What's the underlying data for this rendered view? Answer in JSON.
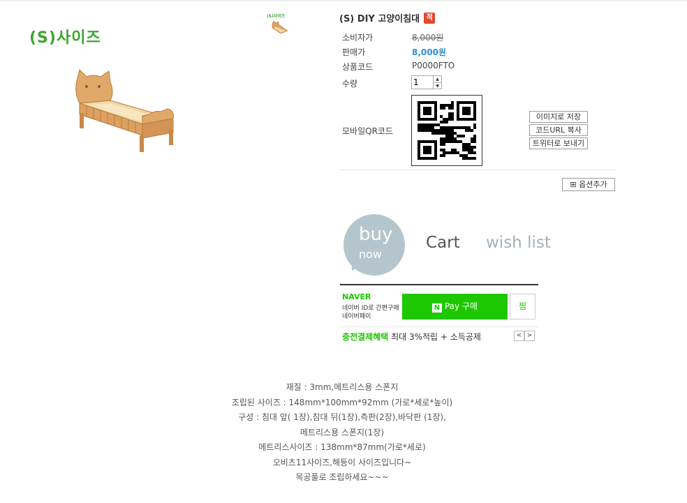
{
  "product": {
    "size_label": "(S)사이즈",
    "thumb_label": "(S)사이즈",
    "title": "(S) DIY 고양이침대",
    "badge": "적"
  },
  "info": {
    "consumer_price_label": "소비자가",
    "consumer_price": "8,000원",
    "sale_price_label": "판매가",
    "sale_price": "8,000원",
    "code_label": "상품코드",
    "code": "P0000FTO",
    "qty_label": "수량",
    "qty_value": "1",
    "qr_label": "모바일QR코드"
  },
  "share": {
    "save_image": "이미지로 저장",
    "copy_url": "코드URL 복사",
    "twitter": "트위터로 보내기"
  },
  "option_add": "옵션추가",
  "actions": {
    "buy_top": "buy",
    "buy_bottom": "now",
    "cart": "Cart",
    "wish": "wish list"
  },
  "npay": {
    "logo": "NAVER",
    "line1": "네이버 ID로 간편구매",
    "line2": "네이버페이",
    "pay_label": "Pay 구매",
    "pay_logo": "N",
    "jjim": "찜"
  },
  "benefit": {
    "label": "충전결제혜택",
    "text": "최대 3%적립 + 소득공제"
  },
  "description": [
    "재질 : 3mm,메트리스용 스폰지",
    "조립된 사이즈 : 148mm*100mm*92mm (가로*세로*높이)",
    "구성 : 침대 앞( 1장),침대 뒤(1장),측판(2장),바닥판 (1장),",
    "메트리스용 스폰지(1장)",
    "메트리스사이즈 : 138mm*87mm(가로*세로)",
    "오비츠11사이즈,해등이 사이즈입니다~",
    "목공풀로 조립하세요~~~"
  ],
  "colors": {
    "accent_green": "#1ec800",
    "size_green": "#3aa52f",
    "price_blue": "#2a8dd1",
    "buy_bubble": "#b4c5cd"
  }
}
